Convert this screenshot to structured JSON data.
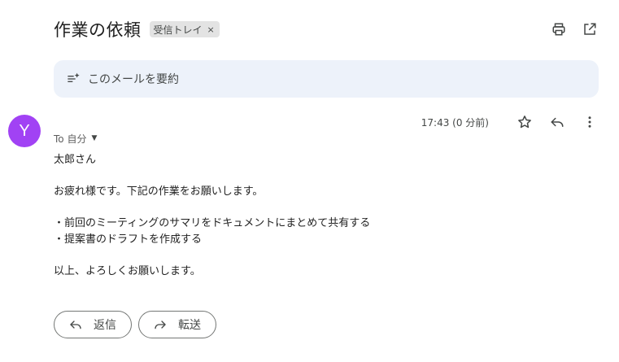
{
  "email": {
    "subject": "作業の依頼",
    "label": "受信トレイ",
    "label_remove": "×",
    "sender_initial": "Y",
    "timestamp": "17:43 (0 分前)",
    "recipient": "To 自分",
    "body": {
      "greeting": "太郎さん",
      "intro": "お疲れ様です。下記の作業をお願いします。",
      "items": [
        "・前回のミーティングのサマリをドキュメントにまとめて共有する",
        "・提案書のドラフトを作成する"
      ],
      "closing": "以上、よろしくお願いします。"
    }
  },
  "summary": {
    "text": "このメールを要約"
  },
  "actions": {
    "reply": "返信",
    "forward": "転送"
  },
  "icons": {
    "print": "print-icon",
    "open_new_window": "open-in-new-window-icon",
    "summarize": "summarize-sparkle-icon",
    "star": "star-icon",
    "reply": "reply-icon",
    "more": "more-vertical-icon",
    "forward": "forward-icon"
  },
  "colors": {
    "avatar": "#a142f4",
    "summary_bg": "#edf2fa",
    "chip_bg": "#e3e3e3"
  }
}
